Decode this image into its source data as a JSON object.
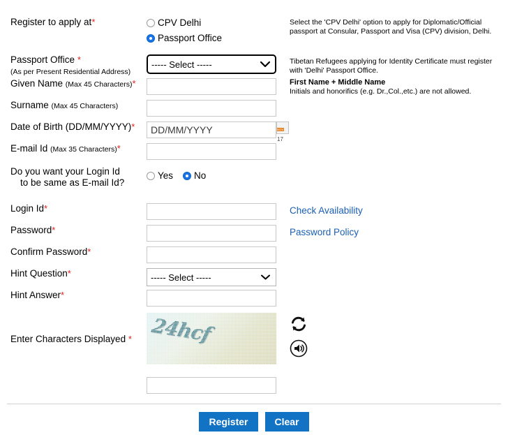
{
  "form": {
    "register_at": {
      "label": "Register to apply at",
      "required": true,
      "options": [
        {
          "label": "CPV Delhi",
          "selected": false
        },
        {
          "label": "Passport Office",
          "selected": true
        }
      ],
      "help": "Select the 'CPV Delhi' option to apply for Diplomatic/Official passport at Consular, Passport and Visa (CPV) division, Delhi."
    },
    "passport_office": {
      "label": "Passport Office",
      "sub_label": "(As per Present Residential Address)",
      "required": true,
      "value": "----- Select -----",
      "help": "Tibetan Refugees applying for Identity Certificate must register with 'Delhi' Passport Office."
    },
    "given_name": {
      "label": "Given Name",
      "sub_label": "(Max 45 Characters)",
      "required": true,
      "value": "",
      "placeholder": "",
      "help_title": "First Name + Middle Name",
      "help": "Initials and honorifics (e.g. Dr.,Col.,etc.) are not allowed."
    },
    "surname": {
      "label": "Surname",
      "sub_label": "(Max 45 Characters)",
      "required": false,
      "value": "",
      "placeholder": ""
    },
    "dob": {
      "label": "Date of Birth (DD/MM/YYYY)",
      "required": true,
      "value": "",
      "placeholder": "DD/MM/YYYY",
      "calendar_icon_month": "NOV",
      "calendar_icon_day": "17"
    },
    "email": {
      "label": "E-mail Id",
      "sub_label": "(Max 35 Characters)",
      "required": true,
      "value": "",
      "placeholder": ""
    },
    "login_same_as_email": {
      "label_line1": "Do you want your Login Id",
      "label_line2": "to be same as E-mail Id?",
      "options": [
        {
          "label": "Yes",
          "selected": false
        },
        {
          "label": "No",
          "selected": true
        }
      ]
    },
    "login_id": {
      "label": "Login Id",
      "required": true,
      "value": "",
      "placeholder": "",
      "link": "Check Availability"
    },
    "password": {
      "label": "Password",
      "required": true,
      "value": "",
      "placeholder": "",
      "link": "Password Policy"
    },
    "confirm_password": {
      "label": "Confirm Password",
      "required": true,
      "value": "",
      "placeholder": ""
    },
    "hint_question": {
      "label": "Hint Question",
      "required": true,
      "value": "----- Select -----"
    },
    "hint_answer": {
      "label": "Hint Answer",
      "required": true,
      "value": "",
      "placeholder": ""
    },
    "captcha": {
      "label": "Enter Characters Displayed",
      "required": true,
      "image_text": "24hcf",
      "refresh_icon": "refresh-icon",
      "audio_icon": "audio-speaker-icon",
      "value": "",
      "placeholder": ""
    },
    "buttons": {
      "register": "Register",
      "clear": "Clear"
    }
  },
  "colors": {
    "required_star": "#e02020",
    "link": "#1a5fb4",
    "button": "#1272c4",
    "radio_selected": "#1a73e8",
    "calendar_header": "#e8821e"
  }
}
